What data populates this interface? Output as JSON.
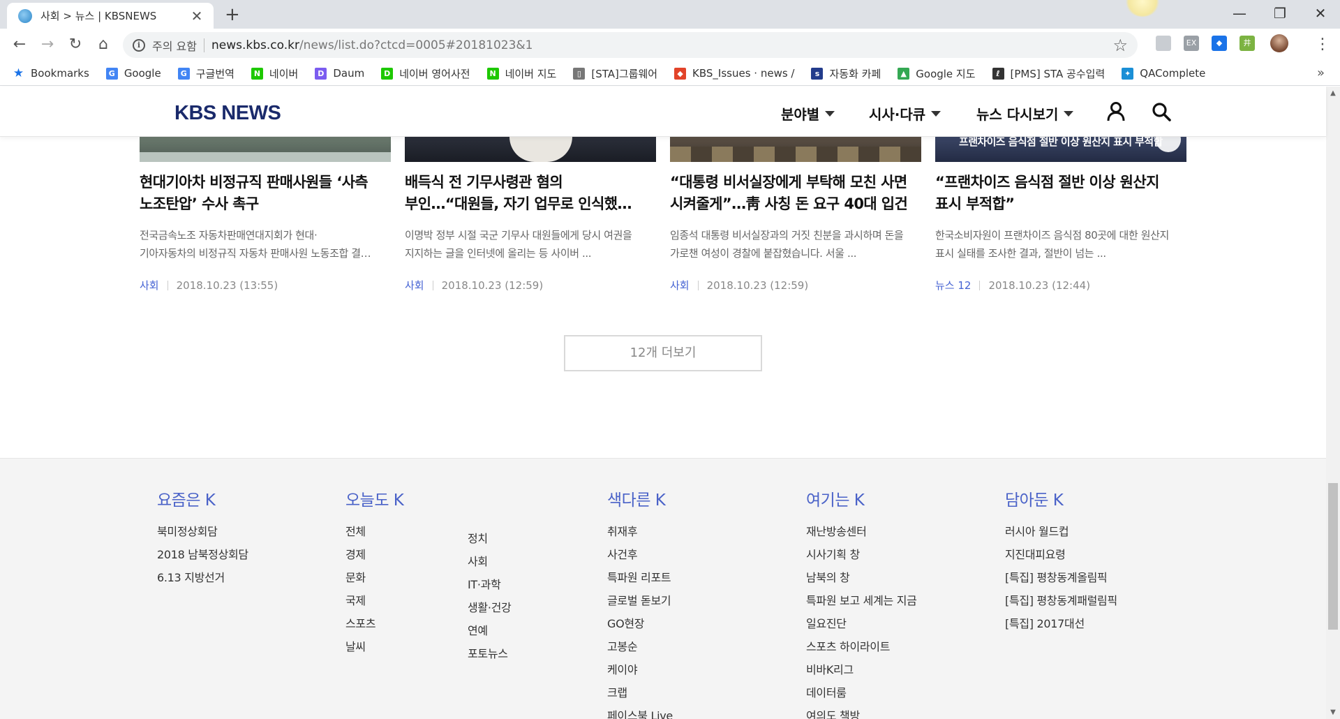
{
  "browser": {
    "tab_title": "사회 > 뉴스 | KBSNEWS",
    "tab_close": "✕",
    "new_tab": "+",
    "security_label": "주의 요함",
    "url_host": "news.kbs.co.kr",
    "url_path": "/news/list.do?ctcd=0005#20181023&1",
    "window_controls": {
      "minimize": "—",
      "maximize": "❐",
      "close": "✕"
    }
  },
  "bookmarks": [
    {
      "label": "Bookmarks",
      "icon": "star-icon",
      "color": "#1a73e8",
      "glyph": "★"
    },
    {
      "label": "Google",
      "icon": "google-icon",
      "color": "#4285f4",
      "glyph": "G"
    },
    {
      "label": "구글번역",
      "icon": "translate-icon",
      "color": "#4285f4",
      "glyph": "G"
    },
    {
      "label": "네이버",
      "icon": "naver-icon",
      "color": "#1ec800",
      "glyph": "N"
    },
    {
      "label": "Daum",
      "icon": "daum-icon",
      "color": "#7b5cf0",
      "glyph": "D"
    },
    {
      "label": "네이버 영어사전",
      "icon": "dict-icon",
      "color": "#1ec800",
      "glyph": "D"
    },
    {
      "label": "네이버 지도",
      "icon": "naver-map-icon",
      "color": "#1ec800",
      "glyph": "N"
    },
    {
      "label": "[STA]그룹웨어",
      "icon": "page-icon",
      "color": "#777777",
      "glyph": "▯"
    },
    {
      "label": "KBS_Issues · news / ",
      "icon": "gitlab-icon",
      "color": "#e24329",
      "glyph": "◆"
    },
    {
      "label": "자동화 카페",
      "icon": "sta-icon",
      "color": "#233c8c",
      "glyph": "s"
    },
    {
      "label": "Google 지도",
      "icon": "google-maps-icon",
      "color": "#34a853",
      "glyph": "▲"
    },
    {
      "label": "[PMS] STA 공수입력",
      "icon": "pms-icon",
      "color": "#333333",
      "glyph": "ℓ"
    },
    {
      "label": "QAComplete",
      "icon": "qacomplete-icon",
      "color": "#1a8fd6",
      "glyph": "✦"
    }
  ],
  "site": {
    "logo": "KBS NEWS",
    "nav": [
      "분야별",
      "시사·다큐",
      "뉴스 다시보기"
    ]
  },
  "articles": [
    {
      "title_line1": "현대기아차 비정규직 판매사원들 ‘사측",
      "title_line2": "노조탄압’ 수사 촉구",
      "desc_line1": "전국금속노조 자동차판매연대지회가 현대·",
      "desc_line2": "기아자동차의 비정규직 자동차 판매사원 노동조합 결…",
      "category": "사회",
      "date": "2018.10.23 (13:55)"
    },
    {
      "title_line1": "배득식 전 기무사령관 혐의",
      "title_line2": "부인…“대원들, 자기 업무로 인식했…",
      "desc_line1": "이명박 정부 시절 국군 기무사 대원들에게 당시 여권을",
      "desc_line2": "지지하는 글을 인터넷에 올리는 등 사이버 ...",
      "category": "사회",
      "date": "2018.10.23 (12:59)"
    },
    {
      "title_line1": "“대통령 비서실장에게 부탁해 모친 사면",
      "title_line2": "시켜줄게”…靑 사칭 돈 요구 40대 입건",
      "desc_line1": "임종석 대통령 비서실장과의 거짓 친분을 과시하며 돈을",
      "desc_line2": "가로챈 여성이 경찰에 붙잡혔습니다. 서울 ...",
      "category": "사회",
      "date": "2018.10.23 (12:59)"
    },
    {
      "title_line1": "“프랜차이즈 음식점 절반 이상 원산지",
      "title_line2": "표시 부적합”",
      "desc_line1": "한국소비자원이 프랜차이즈 음식점 80곳에 대한 원산지",
      "desc_line2": "표시 실태를 조사한 결과, 절반이 넘는 ...",
      "category": "뉴스 12",
      "date": "2018.10.23 (12:44)",
      "thumb_caption": "프랜차이즈 음식점 절반 이상 원산지 표시 부적합"
    }
  ],
  "more_button": "12개 더보기",
  "footer": {
    "col1": {
      "heading": "요즘은 K",
      "items": [
        "북미정상회담",
        "2018 남북정상회담",
        "6.13 지방선거"
      ]
    },
    "col2": {
      "heading": "오늘도 K",
      "items_a": [
        "전체",
        "경제",
        "문화",
        "국제",
        "스포츠",
        "날씨"
      ],
      "items_b": [
        "정치",
        "사회",
        "IT·과학",
        "생활·건강",
        "연예",
        "포토뉴스"
      ]
    },
    "col3": {
      "heading": "색다른 K",
      "items": [
        "취재후",
        "사건후",
        "특파원 리포트",
        "글로벌 돋보기",
        "GO현장",
        "고봉순",
        "케이야",
        "크랩",
        "페이스북 Live"
      ]
    },
    "col4": {
      "heading": "여기는 K",
      "items": [
        "재난방송센터",
        "시사기획 창",
        "남북의 창",
        "특파원 보고 세계는 지금",
        "일요진단",
        "스포츠 하이라이트",
        "비바K리그",
        "데이터룸",
        "여의도 책방"
      ]
    },
    "col5": {
      "heading": "담아둔 K",
      "items": [
        "러시아 월드컵",
        "지진대피요령",
        "[특집] 평창동계올림픽",
        "[특집] 평창동계패럴림픽",
        "[특집] 2017대선"
      ]
    }
  },
  "colors": {
    "accent": "#4a62c8",
    "logo": "#1a2a6b",
    "category": "#4462d3"
  }
}
